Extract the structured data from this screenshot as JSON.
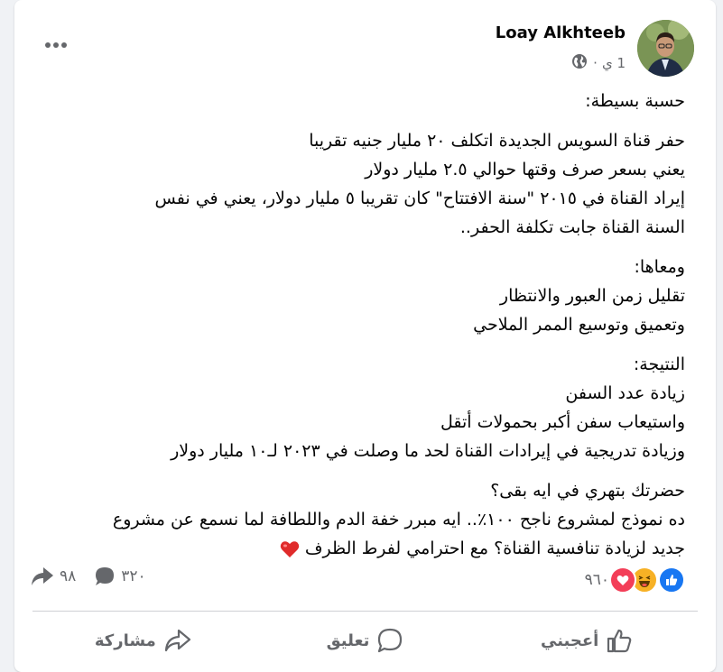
{
  "post": {
    "author": "Loay Alkhteeb",
    "time": "1 ي",
    "separator": "·",
    "body": [
      "حسبة بسيطة:",
      "حفر قناة السويس الجديدة اتكلف ٢٠ مليار جنيه تقريبا",
      "يعني بسعر صرف وقتها حوالي ٢.٥ مليار دولار",
      "إيراد القناة في ٢٠١٥ \"سنة الافتتاح\" كان تقريبا ٥ مليار دولار، يعني في نفس",
      "السنة القناة جابت تكلفة الحفر..",
      "ومعاها:",
      "تقليل زمن العبور والانتظار",
      "وتعميق وتوسيع الممر الملاحي",
      "النتيجة:",
      "زيادة عدد السفن",
      "واستيعاب سفن أكبر بحمولات أتقل",
      "وزيادة تدريجية في إيرادات القناة لحد ما وصلت في ٢٠٢٣ لـ١٠ مليار دولار",
      "حضرتك بتهري في ايه بقى؟",
      "ده نموذج لمشروع ناجح ١٠٠٪.. ايه مبرر خفة الدم واللطافة لما نسمع عن مشروع",
      "جديد لزيادة تنافسية القناة؟ مع احترامي لفرط الظرف"
    ]
  },
  "stats": {
    "reactions_count": "٩٦٠",
    "comments_count": "٣٢٠",
    "shares_count": "٩٨"
  },
  "actions": {
    "like": "أعجبني",
    "comment": "تعليق",
    "share": "مشاركة"
  },
  "colors": {
    "like_blue": "#1877f2",
    "love_red": "#f33e58",
    "haha_yellow": "#f7b125",
    "muted": "#65676b"
  },
  "icons": [
    "globe-icon",
    "more-icon",
    "share-arrow-icon",
    "comment-bubble-icon",
    "like-reaction-icon",
    "love-reaction-icon",
    "haha-reaction-icon",
    "thumbs-up-icon",
    "heart-emoji"
  ]
}
